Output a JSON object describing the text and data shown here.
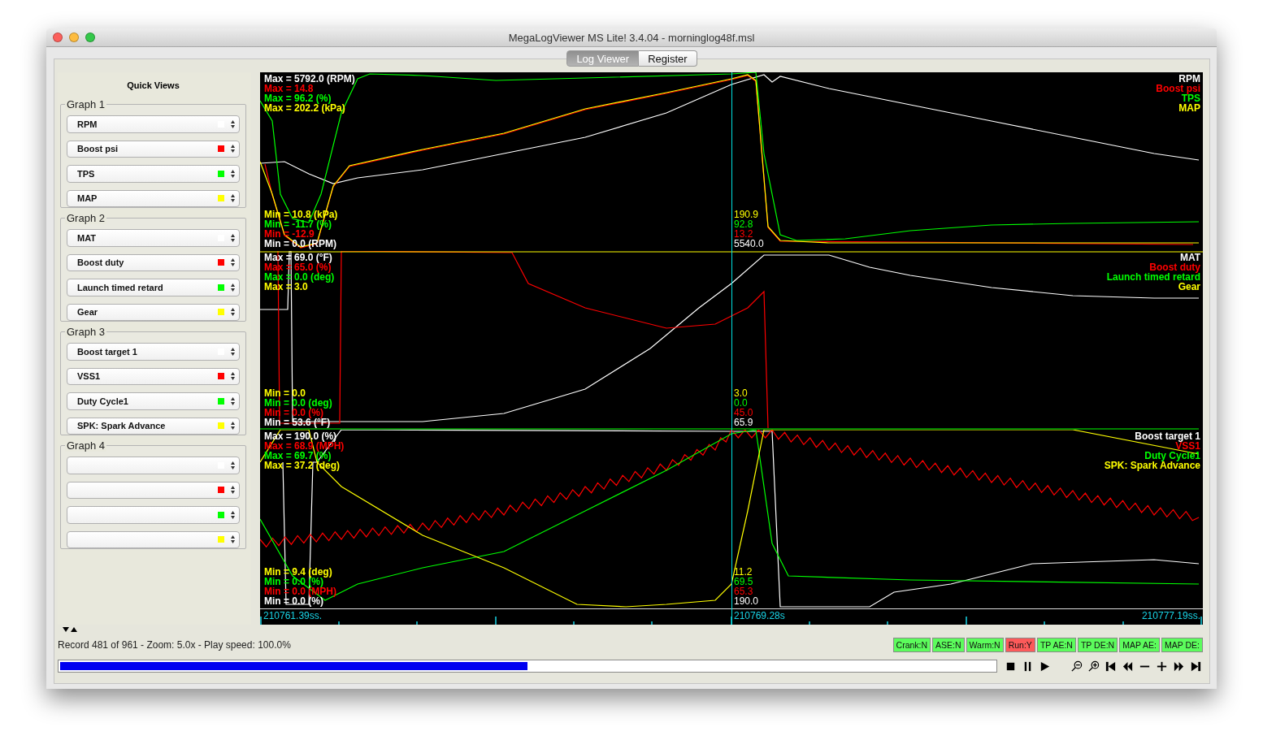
{
  "window": {
    "title": "MegaLogViewer MS Lite! 3.4.04 - morninglog48f.msl"
  },
  "tabs": [
    {
      "label": "Log Viewer",
      "selected": true
    },
    {
      "label": "Register",
      "selected": false
    }
  ],
  "quick_views": {
    "title": "Quick Views",
    "groups": [
      {
        "title": "Graph 1",
        "fields": [
          {
            "value": "RPM",
            "color": "#ffffff"
          },
          {
            "value": "Boost psi",
            "color": "#ff0000"
          },
          {
            "value": "TPS",
            "color": "#00ff00"
          },
          {
            "value": "MAP",
            "color": "#ffff00"
          }
        ]
      },
      {
        "title": "Graph 2",
        "fields": [
          {
            "value": "MAT",
            "color": "#ffffff"
          },
          {
            "value": "Boost duty",
            "color": "#ff0000"
          },
          {
            "value": "Launch timed retard",
            "color": "#00ff00"
          },
          {
            "value": "Gear",
            "color": "#ffff00"
          }
        ]
      },
      {
        "title": "Graph 3",
        "fields": [
          {
            "value": "Boost target 1",
            "color": "#ffffff"
          },
          {
            "value": "VSS1",
            "color": "#ff0000"
          },
          {
            "value": "Duty Cycle1",
            "color": "#00ff00"
          },
          {
            "value": "SPK: Spark Advance",
            "color": "#ffff00"
          }
        ]
      },
      {
        "title": "Graph 4",
        "fields": [
          {
            "color": "#ffffff"
          },
          {
            "color": "#ff0000"
          },
          {
            "color": "#00ff00"
          },
          {
            "color": "#ffff00"
          }
        ]
      }
    ]
  },
  "graphs": [
    {
      "max_labels": [
        {
          "text": "Max = 5792.0 (RPM)",
          "color": "#ffffff"
        },
        {
          "text": "Max = 14.8",
          "color": "#ff0000"
        },
        {
          "text": "Max = 96.2 (%)",
          "color": "#00ff00"
        },
        {
          "text": "Max = 202.2 (kPa)",
          "color": "#ffff00"
        }
      ],
      "min_labels": [
        {
          "text": "Min = 10.8 (kPa)",
          "color": "#ffff00"
        },
        {
          "text": "Min = -11.7 (%)",
          "color": "#00ff00"
        },
        {
          "text": "Min = -12.9",
          "color": "#ff0000"
        },
        {
          "text": "Min = 0.0 (RPM)",
          "color": "#ffffff"
        }
      ],
      "cursor_values": [
        {
          "text": "190.9",
          "color": "#ffff00"
        },
        {
          "text": "92.8",
          "color": "#00ff00"
        },
        {
          "text": "13.2",
          "color": "#ff0000"
        },
        {
          "text": "5540.0",
          "color": "#ffffff"
        }
      ],
      "legend": [
        {
          "text": "RPM",
          "color": "#ffffff"
        },
        {
          "text": "Boost psi",
          "color": "#ff0000"
        },
        {
          "text": "TPS",
          "color": "#00ff00"
        },
        {
          "text": "MAP",
          "color": "#ffff00"
        }
      ]
    },
    {
      "max_labels": [
        {
          "text": "Max = 69.0 (°F)",
          "color": "#ffffff"
        },
        {
          "text": "Max = 65.0 (%)",
          "color": "#ff0000"
        },
        {
          "text": "Max = 0.0 (deg)",
          "color": "#00ff00"
        },
        {
          "text": "Max = 3.0",
          "color": "#ffff00"
        }
      ],
      "min_labels": [
        {
          "text": "Min = 0.0",
          "color": "#ffff00"
        },
        {
          "text": "Min = 0.0 (deg)",
          "color": "#00ff00"
        },
        {
          "text": "Min = 0.0 (%)",
          "color": "#ff0000"
        },
        {
          "text": "Min = 53.6 (°F)",
          "color": "#ffffff"
        }
      ],
      "cursor_values": [
        {
          "text": "3.0",
          "color": "#ffff00"
        },
        {
          "text": "0.0",
          "color": "#00ff00"
        },
        {
          "text": "45.0",
          "color": "#ff0000"
        },
        {
          "text": "65.9",
          "color": "#ffffff"
        }
      ],
      "legend": [
        {
          "text": "MAT",
          "color": "#ffffff"
        },
        {
          "text": "Boost duty",
          "color": "#ff0000"
        },
        {
          "text": "Launch timed retard",
          "color": "#00ff00"
        },
        {
          "text": "Gear",
          "color": "#ffff00"
        }
      ]
    },
    {
      "max_labels": [
        {
          "text": "Max = 190.0 (%)",
          "color": "#ffffff"
        },
        {
          "text": "Max = 68.9 (MPH)",
          "color": "#ff0000"
        },
        {
          "text": "Max = 69.7 (%)",
          "color": "#00ff00"
        },
        {
          "text": "Max = 37.2 (deg)",
          "color": "#ffff00"
        }
      ],
      "min_labels": [
        {
          "text": "Min = 9.4 (deg)",
          "color": "#ffff00"
        },
        {
          "text": "Min = 0.0 (%)",
          "color": "#00ff00"
        },
        {
          "text": "Min = 0.0 (MPH)",
          "color": "#ff0000"
        },
        {
          "text": "Min = 0.0 (%)",
          "color": "#ffffff"
        }
      ],
      "cursor_values": [
        {
          "text": "11.2",
          "color": "#ffff00"
        },
        {
          "text": "69.5",
          "color": "#00ff00"
        },
        {
          "text": "65.3",
          "color": "#ff0000"
        },
        {
          "text": "190.0",
          "color": "#ffffff"
        }
      ],
      "legend": [
        {
          "text": "Boost target 1",
          "color": "#ffffff"
        },
        {
          "text": "VSS1",
          "color": "#ff0000"
        },
        {
          "text": "Duty Cycle1",
          "color": "#00ff00"
        },
        {
          "text": "SPK: Spark Advance",
          "color": "#ffff00"
        }
      ]
    }
  ],
  "time_axis": {
    "start": "210761.39ss.",
    "cursor": "210769.28s",
    "end": "210777.19ss."
  },
  "status": {
    "text": "Record 481 of 961 - Zoom: 5.0x - Play speed: 100.0%"
  },
  "indicators": [
    {
      "label": "Crank:N",
      "active": false
    },
    {
      "label": "ASE:N",
      "active": false
    },
    {
      "label": "Warm:N",
      "active": false
    },
    {
      "label": "Run:Y",
      "active": true
    },
    {
      "label": "TP AE:N",
      "active": false
    },
    {
      "label": "TP DE:N",
      "active": false
    },
    {
      "label": "MAP AE:",
      "active": false
    },
    {
      "label": "MAP DE:",
      "active": false
    }
  ],
  "progress": {
    "level": 0.5
  }
}
